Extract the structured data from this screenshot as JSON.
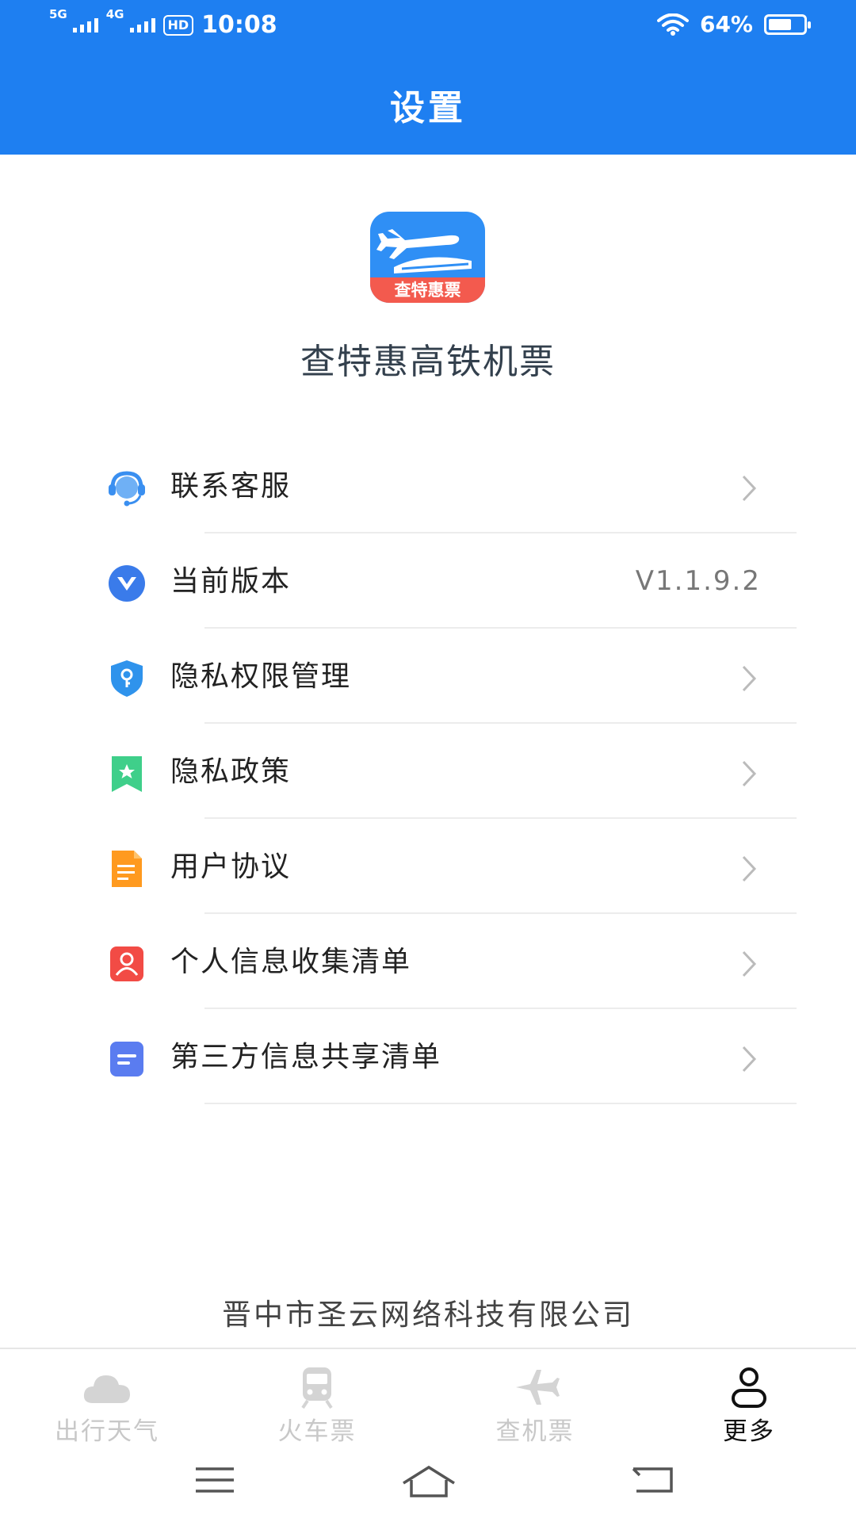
{
  "status_bar": {
    "net1": "5G",
    "net2": "4G",
    "hd": "HD",
    "time": "10:08",
    "battery_percent": "64%",
    "battery_level": 0.64
  },
  "header": {
    "title": "设置"
  },
  "app": {
    "logo_text": "查特惠票",
    "name": "查特惠高铁机票"
  },
  "settings": [
    {
      "label": "联系客服",
      "icon": "customer-service-icon",
      "color": "#3a8ff0"
    },
    {
      "label": "当前版本",
      "icon": "version-icon",
      "color": "#3a7bea",
      "value": "V1.1.9.2"
    },
    {
      "label": "隐私权限管理",
      "icon": "shield-key-icon",
      "color": "#2f93ec"
    },
    {
      "label": "隐私政策",
      "icon": "bookmark-star-icon",
      "color": "#3fcf8a"
    },
    {
      "label": "用户协议",
      "icon": "document-icon",
      "color": "#ff9a1f"
    },
    {
      "label": "个人信息收集清单",
      "icon": "person-card-icon",
      "color": "#f24b45"
    },
    {
      "label": "第三方信息共享清单",
      "icon": "list-card-icon",
      "color": "#5a7cf0"
    }
  ],
  "footer": {
    "company": "晋中市圣云网络科技有限公司"
  },
  "tabs": [
    {
      "label": "出行天气",
      "icon": "cloud-icon",
      "active": false
    },
    {
      "label": "火车票",
      "icon": "train-icon",
      "active": false
    },
    {
      "label": "查机票",
      "icon": "airplane-icon",
      "active": false
    },
    {
      "label": "更多",
      "icon": "person-icon",
      "active": true
    }
  ],
  "colors": {
    "primary": "#1e7ff1",
    "inactive": "#c8c8c8",
    "active": "#111111"
  }
}
